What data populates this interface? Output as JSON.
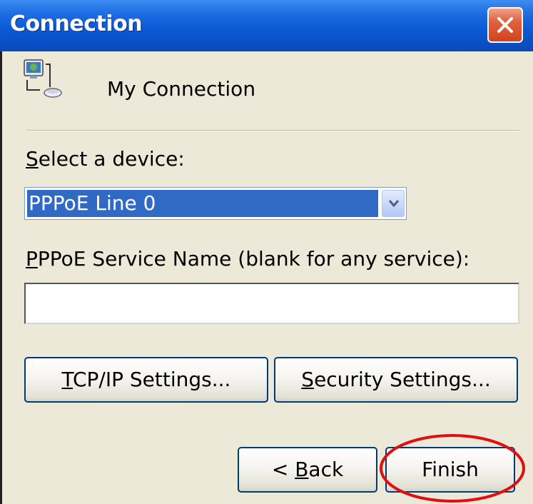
{
  "window": {
    "title": "Connection",
    "close_icon": "close-icon"
  },
  "connection": {
    "icon": "network-connection-icon",
    "name": "My Connection"
  },
  "device": {
    "label_accel": "S",
    "label_rest": "elect a device:",
    "selected": "PPPoE Line 0",
    "dropdown_icon": "chevron-down-icon"
  },
  "service": {
    "label_accel": "P",
    "label_rest": "PPoE Service Name (blank for any service):",
    "value": ""
  },
  "buttons": {
    "tcpip_accel": "T",
    "tcpip_rest": "CP/IP Settings...",
    "security_accel": "S",
    "security_rest": "ecurity Settings...",
    "back_pre": "< ",
    "back_accel": "B",
    "back_rest": "ack",
    "finish": "Finish"
  },
  "colors": {
    "titlebar": "#0a55d4",
    "dialog_bg": "#ece9d8",
    "selection": "#316ac5",
    "close_button": "#e0603f",
    "annotation": "#e01010"
  }
}
